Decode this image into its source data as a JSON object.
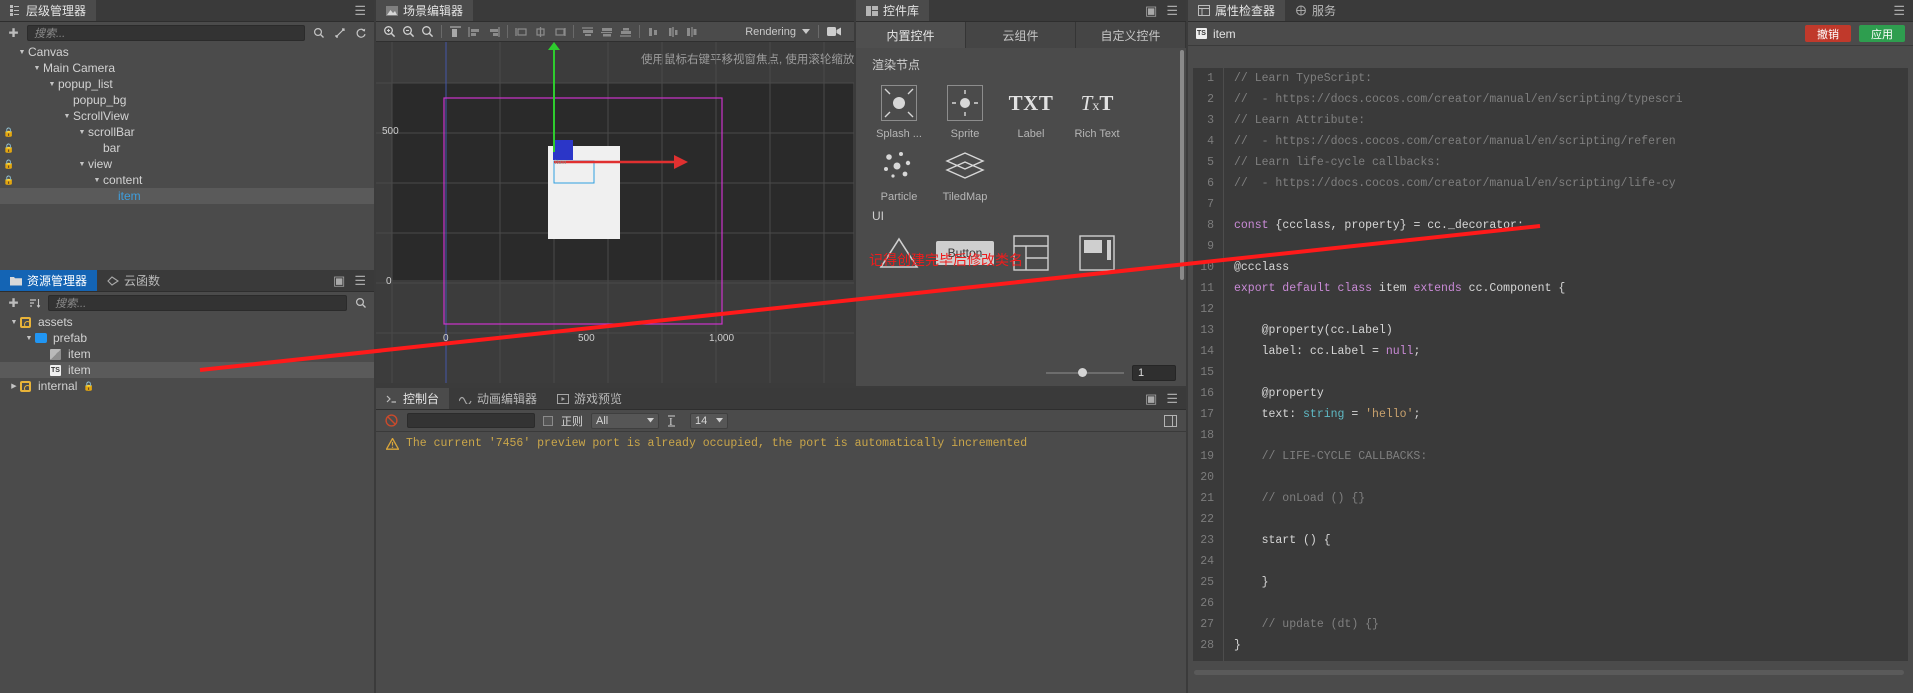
{
  "hierarchy_panel": {
    "tab_label": "层级管理器",
    "tab_icon": "hierarchy-icon",
    "menu_icon": "hamburger-menu-icon",
    "add_icon": "plus-icon",
    "search_placeholder": "搜索...",
    "toolbar_icons": [
      "search-icon",
      "locate-icon",
      "refresh-icon"
    ],
    "nodes": [
      {
        "label": "Canvas",
        "depth": 0,
        "expanded": true,
        "locked": false,
        "selected": false
      },
      {
        "label": "Main Camera",
        "depth": 1,
        "expanded": true,
        "locked": false,
        "selected": false
      },
      {
        "label": "popup_list",
        "depth": 2,
        "expanded": true,
        "locked": false,
        "selected": false
      },
      {
        "label": "popup_bg",
        "depth": 3,
        "expanded": null,
        "locked": false,
        "selected": false
      },
      {
        "label": "ScrollView",
        "depth": 3,
        "expanded": true,
        "locked": false,
        "selected": false
      },
      {
        "label": "scrollBar",
        "depth": 4,
        "expanded": true,
        "locked": true,
        "selected": false
      },
      {
        "label": "bar",
        "depth": 5,
        "expanded": null,
        "locked": true,
        "selected": false
      },
      {
        "label": "view",
        "depth": 4,
        "expanded": true,
        "locked": true,
        "selected": false
      },
      {
        "label": "content",
        "depth": 5,
        "expanded": true,
        "locked": true,
        "selected": false
      },
      {
        "label": "item",
        "depth": 6,
        "expanded": null,
        "locked": false,
        "selected": true
      }
    ]
  },
  "assets_panel": {
    "tabs": [
      {
        "label": "资源管理器",
        "icon": "folder-icon",
        "active": true
      },
      {
        "label": "云函数",
        "icon": "cloud-function-icon",
        "active": false
      }
    ],
    "add_icon": "plus-icon",
    "sort_icon": "sort-icon",
    "search_placeholder": "搜索...",
    "search_icon": "search-icon",
    "items": [
      {
        "label": "assets",
        "depth": 0,
        "icon": "database-icon",
        "expanded": true,
        "selected": false,
        "locked": false
      },
      {
        "label": "prefab",
        "depth": 1,
        "icon": "folder-icon",
        "expanded": true,
        "selected": false,
        "locked": false
      },
      {
        "label": "item",
        "depth": 2,
        "icon": "prefab-icon",
        "expanded": null,
        "selected": false,
        "locked": false
      },
      {
        "label": "item",
        "depth": 2,
        "icon": "typescript-icon",
        "expanded": null,
        "selected": true,
        "locked": false
      },
      {
        "label": "internal",
        "depth": 0,
        "icon": "database-icon",
        "expanded": false,
        "selected": false,
        "locked": true
      }
    ]
  },
  "scene_editor": {
    "tab_label": "场景编辑器",
    "tab_icon": "scene-icon",
    "toolbar_icons": [
      "zoom-in-icon",
      "zoom-out-icon",
      "zoom-fit-icon",
      "align-left-icon",
      "align-center-h-icon",
      "align-right-icon",
      "align-top-icon",
      "align-middle-v-icon",
      "align-bottom-icon",
      "distribute-left-icon",
      "distribute-center-icon",
      "distribute-right-icon",
      "distribute-top-icon",
      "distribute-middle-icon",
      "distribute-bottom-icon"
    ],
    "rendering_label": "Rendering",
    "rendering_caret": "chevron-down-icon",
    "camera_icon": "camera-icon",
    "hint_text": "使用鼠标右键平移视窗焦点, 使用滚轮缩放视图",
    "ruler": {
      "y_ticks": [
        "500",
        "0"
      ],
      "x_ticks": [
        "0",
        "500",
        "1,000"
      ]
    },
    "gizmo": {
      "axis_y_color": "#2ecc2e",
      "axis_x_color": "#e03030",
      "node_color": "#3344dd"
    },
    "selection_rect_color": "#cc33cc"
  },
  "component_library": {
    "tab_label": "控件库",
    "tab_icon": "library-icon",
    "menu_icon": "hamburger-menu-icon",
    "pin_icon": "pin-icon",
    "tabs": [
      {
        "label": "内置控件",
        "active": true
      },
      {
        "label": "云组件",
        "active": false
      },
      {
        "label": "自定义控件",
        "active": false
      }
    ],
    "sections": [
      {
        "title": "渲染节点",
        "items": [
          {
            "label": "Splash ...",
            "icon": "splash-icon"
          },
          {
            "label": "Sprite",
            "icon": "sprite-icon"
          },
          {
            "label": "Label",
            "icon": "txt-icon"
          },
          {
            "label": "Rich Text",
            "icon": "rich-text-icon"
          },
          {
            "label": "Particle",
            "icon": "particle-icon"
          },
          {
            "label": "TiledMap",
            "icon": "tiledmap-icon"
          }
        ]
      },
      {
        "title": "UI",
        "items": [
          {
            "label": "",
            "icon": "triangle-icon"
          },
          {
            "label": "",
            "icon": "button-icon",
            "text": "Button"
          },
          {
            "label": "",
            "icon": "layout-icon"
          },
          {
            "label": "",
            "icon": "scrollview-icon"
          }
        ]
      }
    ],
    "slider_value": "1"
  },
  "console_panel": {
    "tabs": [
      {
        "label": "控制台",
        "icon": "terminal-icon",
        "active": true
      },
      {
        "label": "动画编辑器",
        "icon": "animation-icon",
        "active": false
      },
      {
        "label": "游戏预览",
        "icon": "preview-icon",
        "active": false
      }
    ],
    "clear_icon": "clear-icon",
    "search_placeholder": "",
    "regex_checkbox_label": "正则",
    "filter_value": "All",
    "filter_caret": "chevron-down-icon",
    "font_size_icon": "font-size-icon",
    "font_size_value": "14",
    "font_size_caret": "chevron-down-icon",
    "expand_icon": "expand-icon",
    "menu_icon": "hamburger-menu-icon",
    "pin_icon": "pin-icon",
    "log": {
      "icon": "warning-icon",
      "text": "The current '7456' preview port is already occupied, the port is automatically incremented"
    }
  },
  "inspector_panel": {
    "tabs": [
      {
        "label": "属性检查器",
        "icon": "inspector-icon",
        "active": true
      },
      {
        "label": "服务",
        "icon": "service-icon",
        "active": false
      }
    ],
    "menu_icon": "hamburger-menu-icon",
    "file_icon": "typescript-icon",
    "file_name": "item",
    "undo_label": "撤销",
    "apply_label": "应用",
    "undo_color": "#c0392b",
    "apply_color": "#2e9e4f"
  },
  "code_editor": {
    "lines": [
      {
        "n": "1",
        "segs": [
          [
            "cm",
            "// Learn TypeScript:"
          ]
        ]
      },
      {
        "n": "2",
        "segs": [
          [
            "cm",
            "//  - https://docs.cocos.com/creator/manual/en/scripting/typescri"
          ]
        ]
      },
      {
        "n": "3",
        "segs": [
          [
            "cm",
            "// Learn Attribute:"
          ]
        ]
      },
      {
        "n": "4",
        "segs": [
          [
            "cm",
            "//  - https://docs.cocos.com/creator/manual/en/scripting/referen"
          ]
        ]
      },
      {
        "n": "5",
        "segs": [
          [
            "cm",
            "// Learn life-cycle callbacks:"
          ]
        ]
      },
      {
        "n": "6",
        "segs": [
          [
            "cm",
            "//  - https://docs.cocos.com/creator/manual/en/scripting/life-cy"
          ]
        ]
      },
      {
        "n": "7",
        "segs": []
      },
      {
        "n": "8",
        "segs": [
          [
            "kw",
            "const"
          ],
          [
            "id",
            " {ccclass, property} = cc._decorator;"
          ]
        ]
      },
      {
        "n": "9",
        "segs": []
      },
      {
        "n": "10",
        "segs": [
          [
            "id",
            "@ccclass"
          ]
        ]
      },
      {
        "n": "11",
        "segs": [
          [
            "kw",
            "export default class"
          ],
          [
            "id",
            " item "
          ],
          [
            "kw",
            "extends"
          ],
          [
            "id",
            " cc.Component {"
          ]
        ]
      },
      {
        "n": "12",
        "segs": []
      },
      {
        "n": "13",
        "segs": [
          [
            "id",
            "    @property(cc.Label)"
          ]
        ]
      },
      {
        "n": "14",
        "segs": [
          [
            "id",
            "    label: cc.Label = "
          ],
          [
            "kw",
            "null"
          ],
          [
            "id",
            ";"
          ]
        ]
      },
      {
        "n": "15",
        "segs": []
      },
      {
        "n": "16",
        "segs": [
          [
            "id",
            "    @property"
          ]
        ]
      },
      {
        "n": "17",
        "segs": [
          [
            "id",
            "    text: "
          ],
          [
            "ty",
            "string"
          ],
          [
            "id",
            " = "
          ],
          [
            "st",
            "'hello'"
          ],
          [
            "id",
            ";"
          ]
        ]
      },
      {
        "n": "18",
        "segs": []
      },
      {
        "n": "19",
        "segs": [
          [
            "cm",
            "    // LIFE-CYCLE CALLBACKS:"
          ]
        ]
      },
      {
        "n": "20",
        "segs": []
      },
      {
        "n": "21",
        "segs": [
          [
            "cm",
            "    // onLoad () {}"
          ]
        ]
      },
      {
        "n": "22",
        "segs": []
      },
      {
        "n": "23",
        "segs": [
          [
            "id",
            "    start () {"
          ]
        ]
      },
      {
        "n": "24",
        "segs": []
      },
      {
        "n": "25",
        "segs": [
          [
            "id",
            "    }"
          ]
        ]
      },
      {
        "n": "26",
        "segs": []
      },
      {
        "n": "27",
        "segs": [
          [
            "cm",
            "    // update (dt) {}"
          ]
        ]
      },
      {
        "n": "28",
        "segs": [
          [
            "id",
            "}"
          ]
        ]
      },
      {
        "n": "29",
        "segs": []
      }
    ]
  },
  "annotations": {
    "note_text": "记得创建完毕后修改类名",
    "note_color": "#f01c1c",
    "arrow_color": "#ff1a1a"
  }
}
